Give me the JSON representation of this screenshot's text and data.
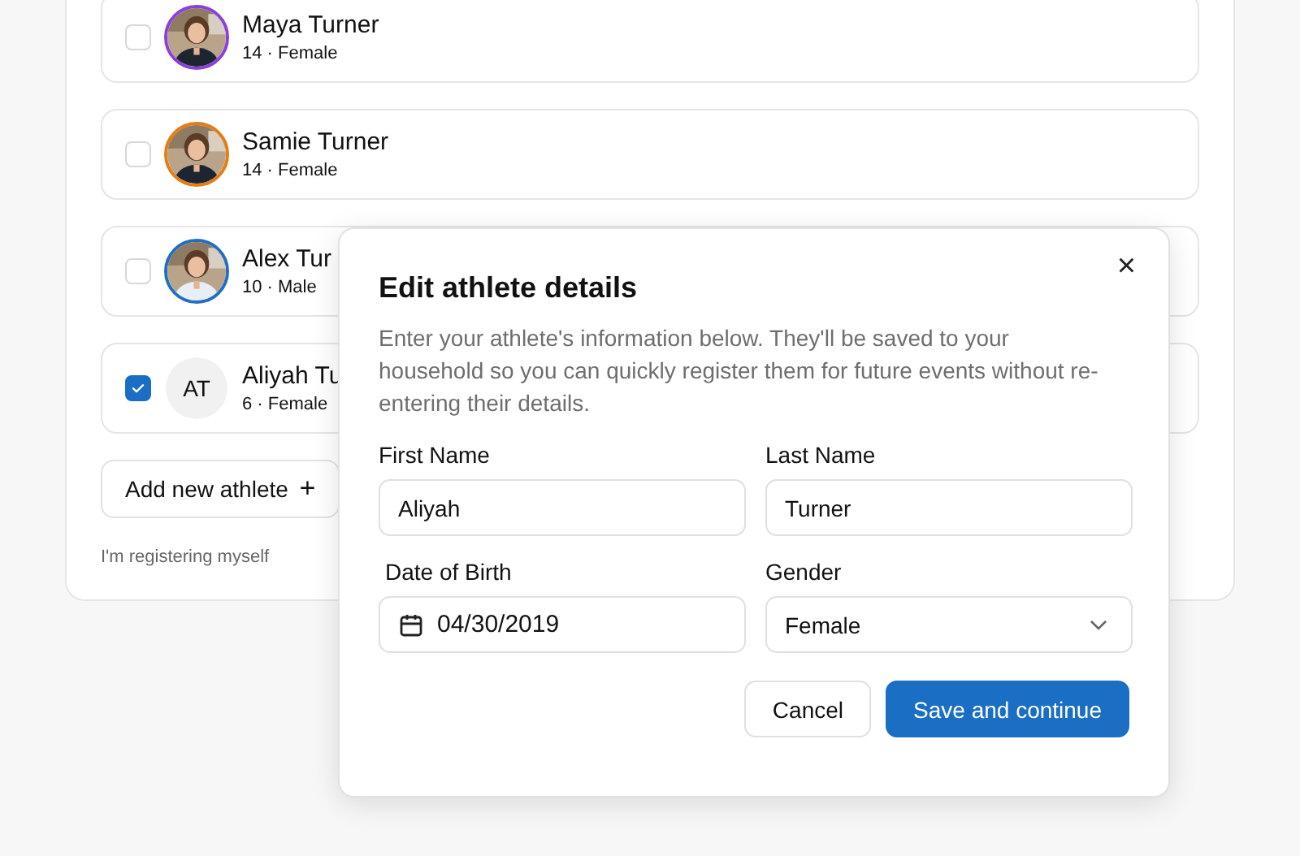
{
  "athletes": [
    {
      "name": "Maya Turner",
      "meta": "14 · Female",
      "checked": false
    },
    {
      "name": "Samie Turner",
      "meta": "14 · Female",
      "checked": false
    },
    {
      "name": "Alex Tur",
      "meta": "10 · Male",
      "checked": false
    },
    {
      "name": "Aliyah Tu",
      "meta": "6 · Female",
      "checked": true,
      "avatar": {
        "kind": "initials",
        "text": "AT"
      }
    }
  ],
  "add_button": {
    "label": "Add new athlete",
    "icon": "+"
  },
  "self_link": "I'm registering myself",
  "dialog": {
    "title": "Edit athlete details",
    "close": "×",
    "description": "Enter your athlete's information below. They'll be saved to your household so you can quickly register them for future events without re-entering their details.",
    "fields": [
      {
        "kind": "text",
        "label": "First Name",
        "value": "Aliyah"
      },
      {
        "kind": "text",
        "label": "Last Name",
        "value": "Turner"
      },
      {
        "kind": "date",
        "label": "Date of Birth",
        "value": "04/30/2019"
      },
      {
        "kind": "select",
        "label": "Gender",
        "value": "Female"
      }
    ],
    "buttons": [
      {
        "label": "Cancel",
        "primary": false
      },
      {
        "label": "Save and continue",
        "primary": true
      }
    ]
  }
}
